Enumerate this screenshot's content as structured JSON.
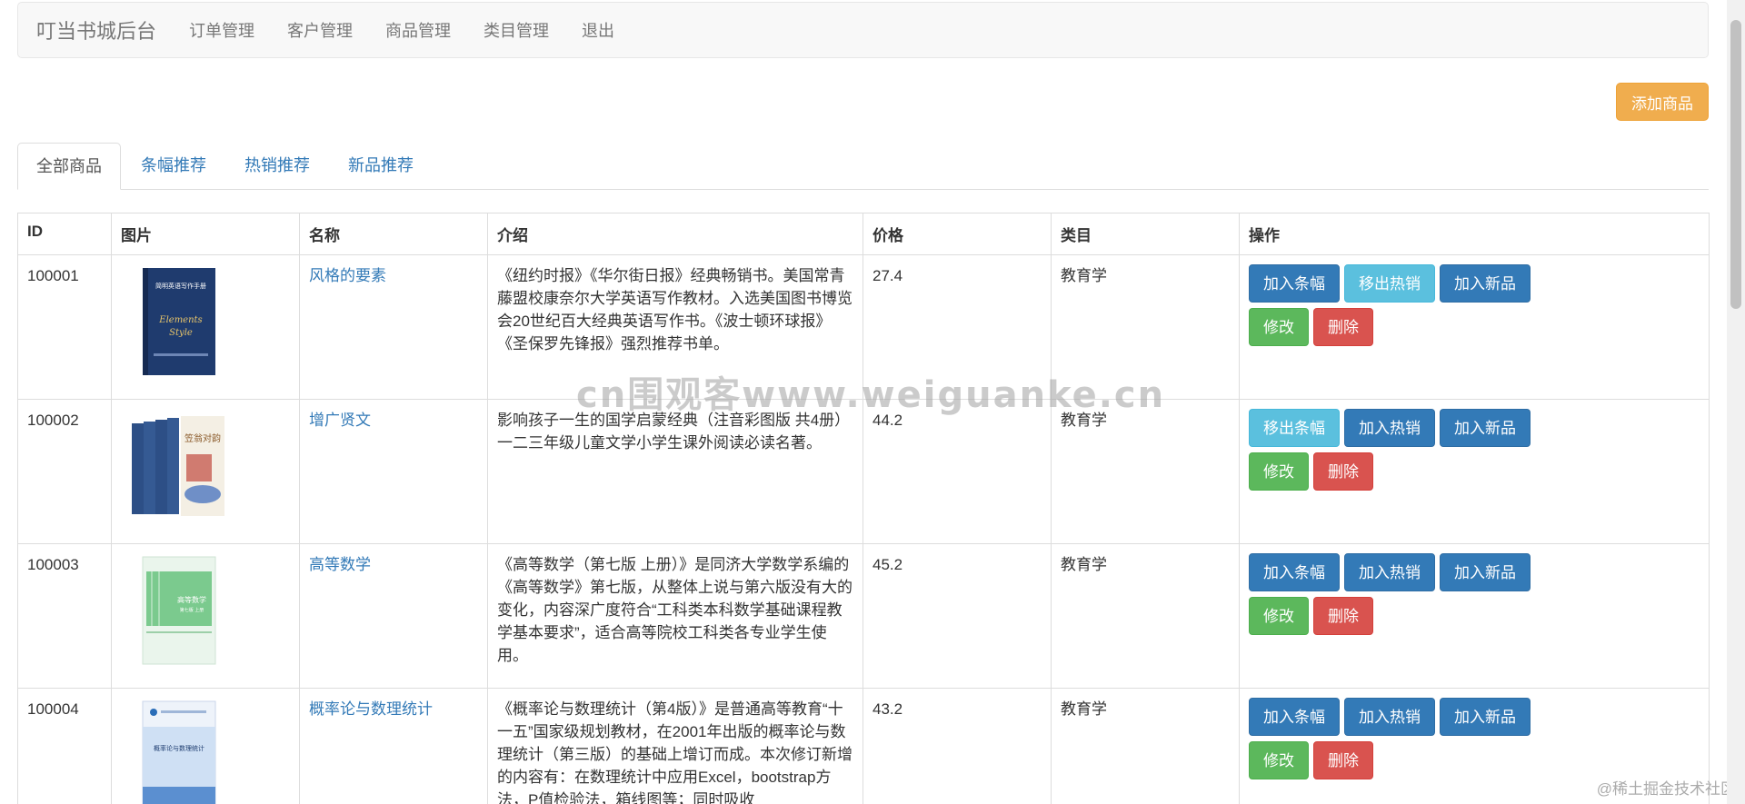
{
  "navbar": {
    "brand": "叮当书城后台",
    "links": [
      "订单管理",
      "客户管理",
      "商品管理",
      "类目管理",
      "退出"
    ]
  },
  "add_button": "添加商品",
  "tabs": [
    "全部商品",
    "条幅推荐",
    "热销推荐",
    "新品推荐"
  ],
  "table": {
    "headers": [
      "ID",
      "图片",
      "名称",
      "介绍",
      "价格",
      "类目",
      "操作"
    ],
    "rows": [
      {
        "id": "100001",
        "name": "风格的要素",
        "intro": "《纽约时报》《华尔街日报》经典畅销书。美国常青藤盟校康奈尔大学英语写作教材。入选美国图书博览会20世纪百大经典英语写作书。《波士顿环球报》《圣保罗先锋报》强烈推荐书单。",
        "price": "27.4",
        "category": "教育学",
        "actions": [
          "加入条幅",
          "移出热销",
          "加入新品",
          "修改",
          "删除"
        ],
        "cover_title": "简明英语写作手册",
        "cover_sub": "Elements Style"
      },
      {
        "id": "100002",
        "name": "增广贤文",
        "intro": "影响孩子一生的国学启蒙经典（注音彩图版 共4册）一二三年级儿童文学小学生课外阅读必读名著。",
        "price": "44.2",
        "category": "教育学",
        "actions": [
          "移出条幅",
          "加入热销",
          "加入新品",
          "修改",
          "删除"
        ],
        "cover_title": "笠翁对韵",
        "cover_sub": ""
      },
      {
        "id": "100003",
        "name": "高等数学",
        "intro": "《高等数学（第七版 上册）》是同济大学数学系编的《高等数学》第七版，从整体上说与第六版没有大的变化，内容深广度符合“工科类本科数学基础课程教学基本要求”，适合高等院校工科类各专业学生使用。",
        "price": "45.2",
        "category": "教育学",
        "actions": [
          "加入条幅",
          "加入热销",
          "加入新品",
          "修改",
          "删除"
        ],
        "cover_title": "高等数学",
        "cover_sub": "第七版 上册"
      },
      {
        "id": "100004",
        "name": "概率论与数理统计",
        "intro": "《概率论与数理统计（第4版）》是普通高等教育“十一五”国家级规划教材，在2001年出版的概率论与数理统计（第三版）的基础上增订而成。本次修订新增的内容有：在数理统计中应用Excel，bootstrap方法，P值检验法，箱线图等；同时吸收",
        "price": "43.2",
        "category": "教育学",
        "actions": [
          "加入条幅",
          "加入热销",
          "加入新品",
          "修改",
          "删除"
        ],
        "cover_title": "概率论与数理统计",
        "cover_sub": ""
      }
    ]
  },
  "watermark": "cn围观客www.weiguanke.cn",
  "corner_watermark": "@稀土掘金技术社区",
  "colors": {
    "primary": "#337ab7",
    "info": "#5bc0de",
    "success": "#5cb85c",
    "danger": "#d9534f",
    "warning": "#f0ad4e"
  }
}
